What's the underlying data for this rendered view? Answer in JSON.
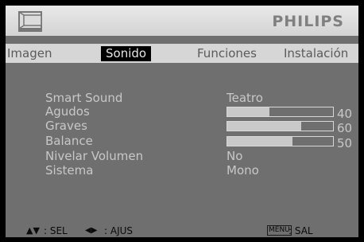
{
  "header": {
    "brand": "PHILIPS",
    "icon": "tv-icon"
  },
  "tabs": [
    {
      "label": "Imagen",
      "active": false
    },
    {
      "label": "Sonido",
      "active": true
    },
    {
      "label": "Funciones",
      "active": false
    },
    {
      "label": "Instalación",
      "active": false
    }
  ],
  "settings": {
    "smart_sound": {
      "label": "Smart Sound",
      "value": "Teatro"
    },
    "agudos": {
      "label": "Agudos",
      "value": 40,
      "level": 0.4
    },
    "graves": {
      "label": "Graves",
      "value": 60,
      "level": 0.7
    },
    "balance": {
      "label": "Balance",
      "value": 50,
      "level": 0.62
    },
    "nivelar_volumen": {
      "label": "Nivelar Volumen",
      "value": "No"
    },
    "sistema": {
      "label": "Sistema",
      "value": "Mono"
    }
  },
  "footer": {
    "sel_icon": "up-down-arrows-icon",
    "sel_label": ": SEL",
    "ajus_icon": "left-right-arrows-icon",
    "ajus_label": ": AJUS",
    "menu_key": "MENU",
    "menu_label": ": SAL"
  },
  "colors": {
    "panel": "#6f6f6f",
    "header": "#e0e0e0",
    "tabs_bar": "#d6d6d6",
    "active_tab": "#000000",
    "text": "#c8c8c8",
    "bar_fill": "#c9c9c9"
  }
}
